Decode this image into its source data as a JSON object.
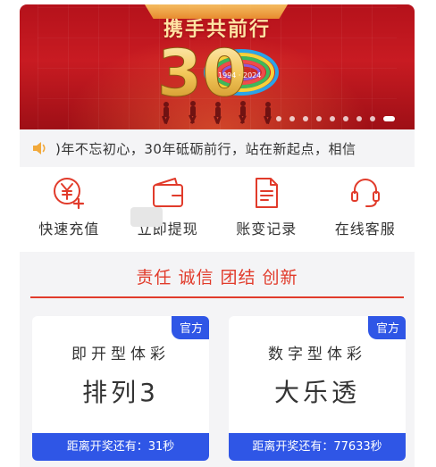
{
  "banner": {
    "headline": "携手共前行",
    "emblem_number": "30",
    "emblem_years": "1994 · 2024",
    "dots_total": 9,
    "active_dot": 0
  },
  "notice": {
    "icon": "speaker-icon",
    "text": ")年不忘初心，30年砥砺前行，站在新起点，相信"
  },
  "actions": [
    {
      "id": "recharge",
      "icon": "yuan-plus-icon",
      "label": "快速充值"
    },
    {
      "id": "withdraw",
      "icon": "wallet-icon",
      "label": "立即提现"
    },
    {
      "id": "records",
      "icon": "document-icon",
      "label": "账变记录"
    },
    {
      "id": "support",
      "icon": "headset-icon",
      "label": "在线客服"
    }
  ],
  "slogan": "责任 诚信 团结 创新",
  "cards": [
    {
      "badge": "官方",
      "category": "即开型体彩",
      "name": "排列3",
      "countdown": "距离开奖还有：31秒"
    },
    {
      "badge": "官方",
      "category": "数字型体彩",
      "name": "大乐透",
      "countdown": "距离开奖还有：77633秒"
    }
  ],
  "colors": {
    "accent_red": "#e13b2b",
    "badge_blue": "#2f56e6",
    "banner_red": "#c81b22"
  }
}
